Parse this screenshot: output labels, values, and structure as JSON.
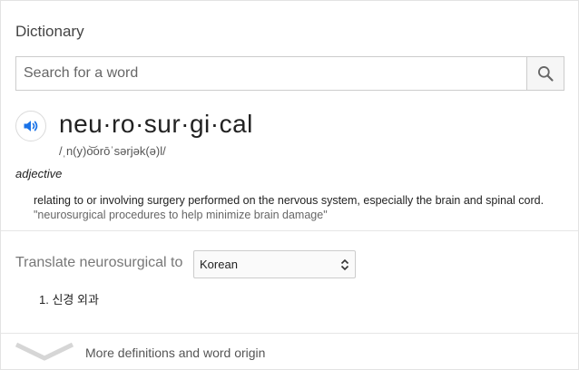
{
  "panel": {
    "title": "Dictionary"
  },
  "search": {
    "placeholder": "Search for a word",
    "button_icon": "search-icon"
  },
  "entry": {
    "audio_icon": "speaker-icon",
    "headword": "neu·ro·sur·gi·cal",
    "phonetic": "/ˌn(y)o͝orōˈsərjək(ə)l/",
    "part_of_speech": "adjective",
    "definition": "relating to or involving surgery performed on the nervous system, especially the brain and spinal cord.",
    "example": "\"neurosurgical procedures to help minimize brain damage\""
  },
  "translate": {
    "label": "Translate neurosurgical to",
    "selected_language": "Korean",
    "result_number": "1.",
    "result": "신경 외과"
  },
  "footer": {
    "more_label": "More definitions and word origin",
    "chevron_icon": "chevron-down-icon"
  },
  "colors": {
    "accent": "#1a73e8",
    "muted": "#777777"
  }
}
